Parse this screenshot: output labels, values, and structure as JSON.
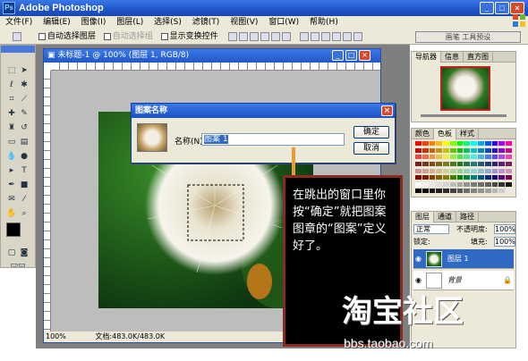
{
  "app": {
    "title": "Adobe Photoshop"
  },
  "menu": [
    "文件(F)",
    "编辑(E)",
    "图像(I)",
    "图层(L)",
    "选择(S)",
    "滤镜(T)",
    "视图(V)",
    "窗口(W)",
    "帮助(H)"
  ],
  "options": {
    "auto_select_layer": "自动选择图层",
    "auto_select_group": "自动选择组",
    "show_transform": "显示变换控件",
    "palette_well": "画笔 工具预设"
  },
  "document": {
    "title": "未标题-1 @ 100% (图层 1, RGB/8)",
    "zoom": "100%",
    "doc_size": "文档:483.0K/483.0K"
  },
  "dialog": {
    "title": "图案名称",
    "name_label": "名称(N):",
    "name_value": "图案 1",
    "ok": "确定",
    "cancel": "取消"
  },
  "panels": {
    "navigator_tabs": [
      "导航器",
      "信息",
      "直方图"
    ],
    "swatch_tabs": [
      "颜色",
      "色板",
      "样式"
    ],
    "layers_tabs": [
      "图层",
      "通道",
      "路径"
    ],
    "blend_mode": "正常",
    "opacity_label": "不透明度:",
    "opacity_value": "100%",
    "lock_label": "锁定:",
    "fill_label": "填充:",
    "fill_value": "100%",
    "layers": [
      {
        "name": "图层 1",
        "selected": true
      },
      {
        "name": "背景",
        "selected": false
      }
    ]
  },
  "annotation": {
    "text": "在跳出的窗口里你按“确定”就把图案图章的“图案”定义好了。",
    "logo": "淘宝社区",
    "url": "bbs.taobao.com"
  },
  "colors": {
    "title_blue": "#1e55c8",
    "callout_border": "#8c2a1e",
    "connector": "#e89a3a",
    "selected_layer": "#316ac5"
  }
}
